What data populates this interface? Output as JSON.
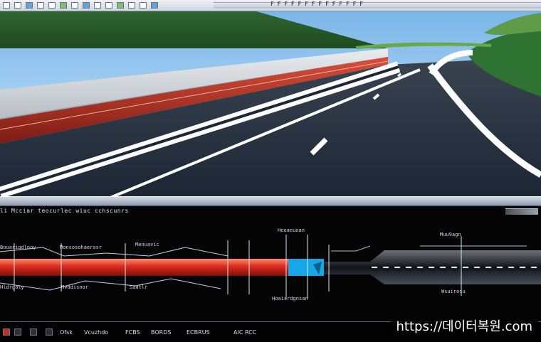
{
  "toolbar": {
    "title_text": "F F F F F F F  F F F F F F F"
  },
  "plan_view": {
    "header_text": "li Mcciar  teocurlec wiuc cchscunrs",
    "labels": [
      "Bouarigdlnoy",
      "Monsosohaerssr",
      "Menuavic",
      "Heoaeuoan",
      "Muu9agn",
      "Hldrgaty",
      "Mvddisnor",
      "Saatlr",
      "Hoaisrdgnsan",
      "Wsuirosu"
    ]
  },
  "status_bar": {
    "items": [
      "Ofsk",
      "Vcuzhdo",
      "FCBS",
      "BORDS",
      "ECBRUS",
      "AIC RCC"
    ]
  },
  "watermark": {
    "text": "https://데이터복원.com"
  }
}
